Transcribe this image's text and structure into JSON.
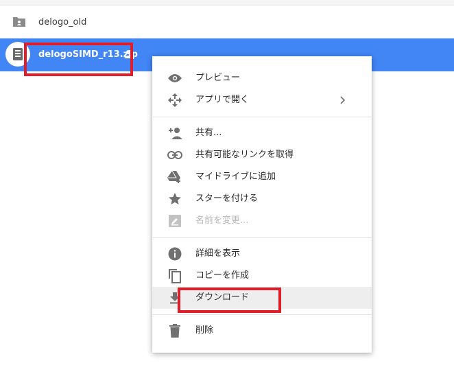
{
  "files": {
    "folder": {
      "name": "delogo_old",
      "icon": "shared-folder-icon"
    },
    "selected": {
      "name": "delogoSIMD_r13.zip",
      "icon": "zip-file-icon",
      "shared_icon": "shared-person-icon"
    }
  },
  "context_menu": {
    "items": [
      {
        "label": "プレビュー",
        "icon": "eye-icon"
      },
      {
        "label": "アプリで開く",
        "icon": "open-with-icon",
        "submenu_icon": "chevron-right-icon"
      },
      {
        "label": "共有...",
        "icon": "person-add-icon"
      },
      {
        "label": "共有可能なリンクを取得",
        "icon": "link-icon"
      },
      {
        "label": "マイドライブに追加",
        "icon": "drive-add-icon"
      },
      {
        "label": "スターを付ける",
        "icon": "star-icon"
      },
      {
        "label": "名前を変更...",
        "icon": "rename-icon",
        "disabled": true
      },
      {
        "label": "詳細を表示",
        "icon": "info-icon"
      },
      {
        "label": "コピーを作成",
        "icon": "copy-icon"
      },
      {
        "label": "ダウンロード",
        "icon": "download-icon",
        "hovered": true
      },
      {
        "label": "削除",
        "icon": "trash-icon"
      }
    ]
  },
  "colors": {
    "selection": "#4285f4",
    "highlight_box": "#e01e2b",
    "icon_gray": "#757575"
  }
}
